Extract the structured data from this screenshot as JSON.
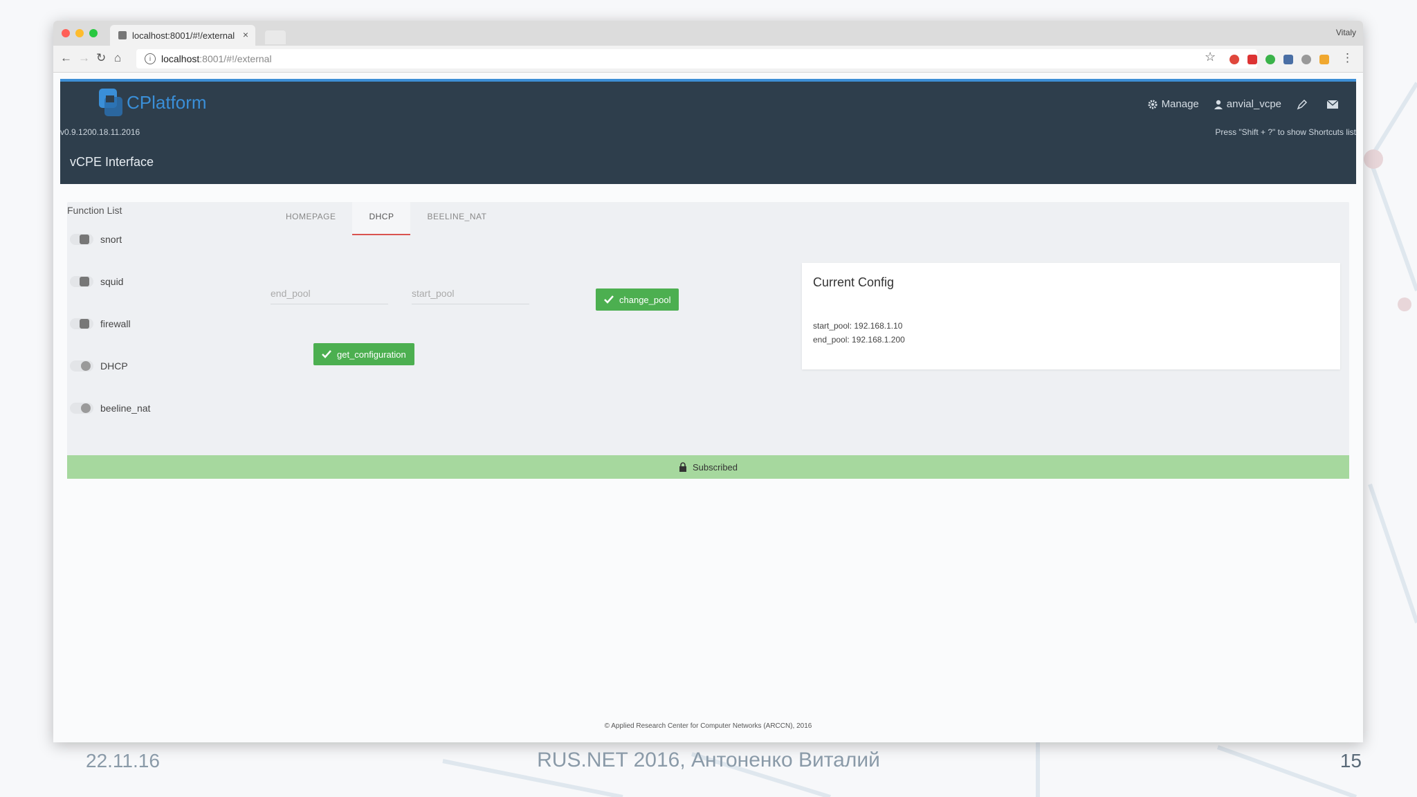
{
  "browser": {
    "tab_title": "localhost:8001/#!/external",
    "tab_close": "×",
    "profile_name": "Vitaly",
    "url_host": "localhost",
    "url_path": ":8001/#!/external"
  },
  "app": {
    "brand": "CPlatform",
    "version": "v0.9.1200.18.11.2016",
    "page_title": "vCPE Interface",
    "header_manage": "Manage",
    "header_user": "anvial_vcpe",
    "shortcut_hint": "Press \"Shift + ?\" to show Shortcuts list"
  },
  "function_list": {
    "title": "Function List",
    "items": [
      {
        "label": "snort",
        "enabled": false
      },
      {
        "label": "squid",
        "enabled": false
      },
      {
        "label": "firewall",
        "enabled": false
      },
      {
        "label": "DHCP",
        "enabled": true
      },
      {
        "label": "beeline_nat",
        "enabled": true
      }
    ]
  },
  "tabs": [
    "HOMEPAGE",
    "DHCP",
    "BEELINE_NAT"
  ],
  "active_tab": "DHCP",
  "dhcp": {
    "end_pool_placeholder": "end_pool",
    "start_pool_placeholder": "start_pool",
    "change_pool_label": "change_pool",
    "get_configuration_label": "get_configuration"
  },
  "config": {
    "title": "Current Config",
    "start_pool": "start_pool: 192.168.1.10",
    "end_pool": "end_pool: 192.168.1.200"
  },
  "status": {
    "subscribed_label": "Subscribed"
  },
  "footer": "© Applied Research Center for Computer Networks (ARCCN), 2016",
  "slide": {
    "date": "22.11.16",
    "title": "RUS.NET 2016, Антоненко Виталий",
    "page_number": "15"
  },
  "colors": {
    "header_bg": "#2e3e4c",
    "header_accent": "#3d8fd6",
    "button_green": "#4caf50",
    "subscribed_green": "#a6d89e",
    "active_tab_underline": "#d9534f"
  }
}
